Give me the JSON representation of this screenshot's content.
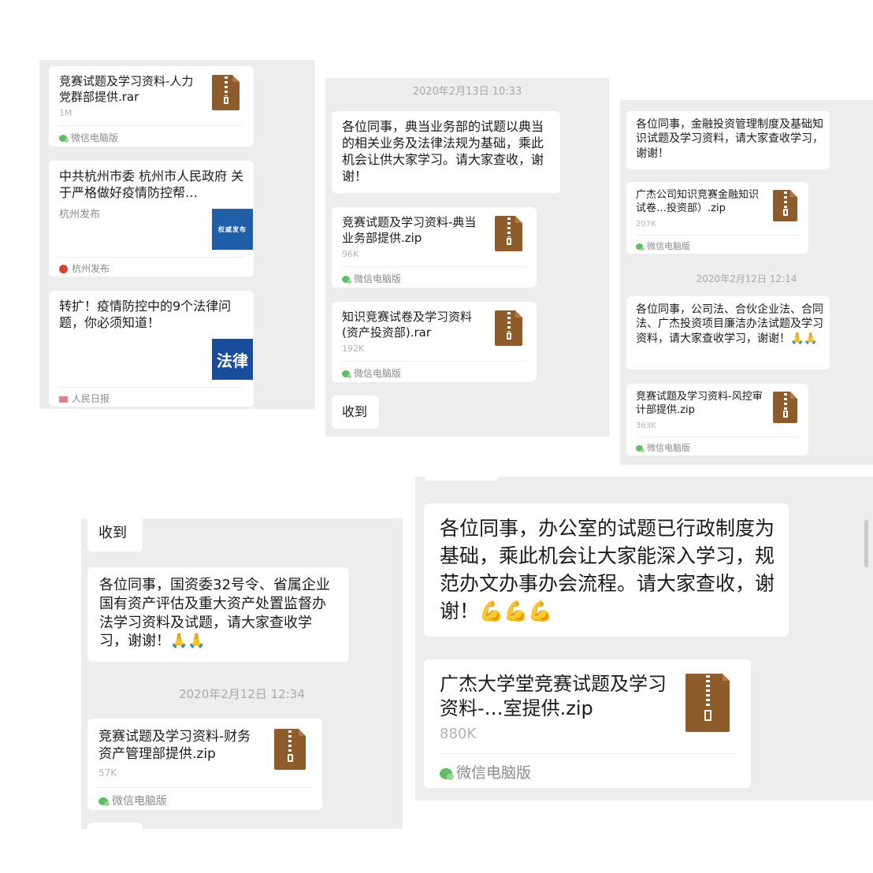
{
  "shot1": {
    "file_title": "竞赛试题及学习资料-人力党群部提供.rar",
    "file_size": "1M",
    "file_source": "微信电脑版",
    "article1": {
      "title": "中共杭州市委 杭州市人民政府 关于严格做好疫情防控帮…",
      "account": "杭州发布",
      "thumb_text": "权威发布",
      "source": "杭州发布"
    },
    "article2": {
      "title": "转扩！疫情防控中的9个法律问题，你必须知道！",
      "thumb_text": "法律",
      "source": "人民日报"
    }
  },
  "shot2": {
    "timestamp": "2020年2月13日 10:33",
    "message": "各位同事，典当业务部的试题以典当的相关业务及法律法规为基础，乘此机会让供大家学习。请大家查收，谢谢！",
    "file1": {
      "title": "竞赛试题及学习资料-典当业务部提供.zip",
      "size": "96K",
      "source": "微信电脑版"
    },
    "file2": {
      "title": "知识竞赛试卷及学习资料(资产投资部).rar",
      "size": "192K",
      "source": "微信电脑版"
    },
    "reply": "收到"
  },
  "shot3": {
    "message1": "各位同事，金融投资管理制度及基础知识试题及学习资料，请大家查收学习，谢谢！",
    "file1": {
      "title": "广杰公司知识竞赛金融知识试卷…投资部）.zip",
      "size": "207K",
      "source": "微信电脑版"
    },
    "timestamp": "2020年2月12日 12:14",
    "message2": "各位同事，公司法、合伙企业法、合同法、广杰投资项目廉洁办法试题及学习资料，请大家查收学习，谢谢！",
    "message2_emoji": "🙏🙏",
    "file2": {
      "title": "竞赛试题及学习资料-风控审计部提供.zip",
      "size": "363K",
      "source": "微信电脑版"
    }
  },
  "shot4": {
    "reply": "收到",
    "message": "各位同事，国资委32号令、省属企业国有资产评估及重大资产处置监督办法学习资料及试题，请大家查收学习，谢谢！",
    "message_emoji": "🙏🙏",
    "timestamp": "2020年2月12日 12:34",
    "file": {
      "title": "竞赛试题及学习资料-财务资产管理部提供.zip",
      "size": "57K",
      "source": "微信电脑版"
    }
  },
  "shot5": {
    "message": "各位同事，办公室的试题已行政制度为基础，乘此机会让大家能深入学习，规范办文办事办会流程。请大家查收，谢谢！",
    "message_emoji": "💪💪💪",
    "file": {
      "title": "广杰大学堂竞赛试题及学习资料-…室提供.zip",
      "size": "880K",
      "source": "微信电脑版"
    }
  },
  "icons": {
    "file": "zip-file-icon",
    "wechat": "wechat-pc-icon"
  },
  "colors": {
    "chat_bg": "#ededed",
    "bubble": "#ffffff",
    "zip_icon": "#8e5c2b",
    "thumb_blue": "#1f5fa8"
  }
}
